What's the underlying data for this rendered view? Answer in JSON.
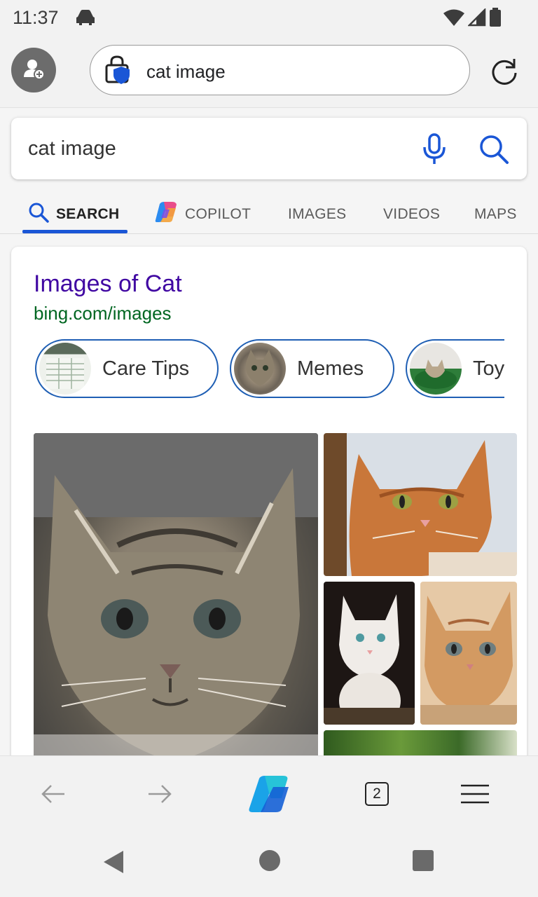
{
  "status_bar": {
    "time": "11:37"
  },
  "toolbar": {
    "address_text": "cat image"
  },
  "search": {
    "query": "cat image"
  },
  "tabs": [
    {
      "label": "SEARCH"
    },
    {
      "label": "COPILOT"
    },
    {
      "label": "IMAGES"
    },
    {
      "label": "VIDEOS"
    },
    {
      "label": "MAPS"
    }
  ],
  "result_card": {
    "title": "Images of Cat",
    "url": "bing.com/images",
    "chips": [
      {
        "label": "Care Tips"
      },
      {
        "label": "Memes"
      },
      {
        "label": "Toys"
      }
    ]
  },
  "bottom_nav": {
    "tab_count": "2"
  },
  "colors": {
    "accent": "#1a56d6",
    "title_link": "#4007a2",
    "url_green": "#006621",
    "chip_border": "#1f5fb4"
  }
}
